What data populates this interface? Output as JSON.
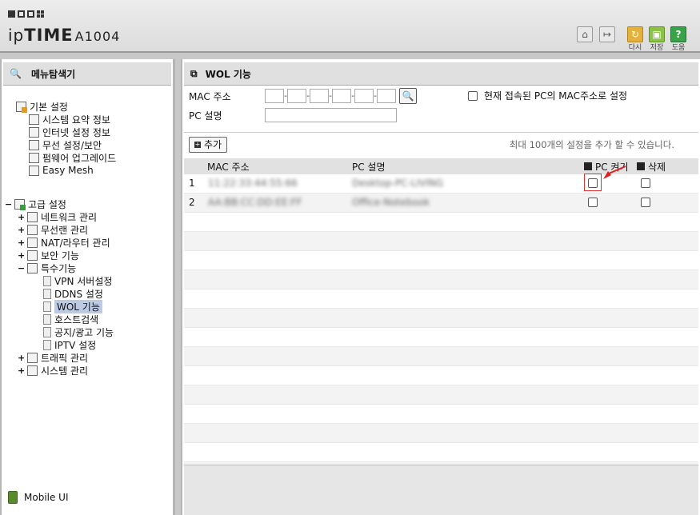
{
  "header": {
    "brand_ip": "ip",
    "brand_time": "TIME",
    "brand_model": "A1004",
    "buttons": [
      {
        "icon": "home-icon",
        "label": ""
      },
      {
        "icon": "logout-icon",
        "label": ""
      },
      {
        "icon": "refresh-icon",
        "label": "다시"
      },
      {
        "icon": "save-icon",
        "label": "저장"
      },
      {
        "icon": "help-icon",
        "label": "도움"
      }
    ],
    "help_glyph": "?"
  },
  "sidebar": {
    "title": "메뉴탐색기",
    "basic": {
      "label": "기본 설정",
      "items": [
        "시스템 요약 정보",
        "인터넷 설정 정보",
        "무선 설정/보안",
        "펌웨어 업그레이드",
        "Easy Mesh"
      ]
    },
    "advanced": {
      "label": "고급 설정",
      "items": [
        "네트워크 관리",
        "무선랜 관리",
        "NAT/라우터 관리",
        "보안 기능"
      ],
      "special": {
        "label": "특수기능",
        "items": [
          "VPN 서버설정",
          "DDNS 설정",
          "WOL 기능",
          "호스트검색",
          "공지/광고 기능",
          "IPTV 설정"
        ]
      },
      "after": [
        "트래픽 관리",
        "시스템 관리"
      ]
    },
    "mobile_ui": "Mobile UI",
    "expand_plus": "+",
    "expand_minus": "−"
  },
  "main": {
    "title": "WOL 기능",
    "mac_label": "MAC 주소",
    "pc_desc_label": "PC 설명",
    "current_pc_label": "현재 접속된 PC의 MAC주소로 설정",
    "add_button": "추가",
    "limit_note": "최대 100개의 설정을 추가 할 수 있습니다.",
    "table": {
      "headers": {
        "mac": "MAC 주소",
        "desc": "PC 설명",
        "wake": "PC 켜기",
        "delete": "삭제"
      },
      "rows": [
        {
          "num": "1",
          "mac": "11:22:33:44:55:66",
          "desc": "Desktop-PC-LIVING"
        },
        {
          "num": "2",
          "mac": "AA:BB:CC:DD:EE:FF",
          "desc": "Office-Notebook"
        }
      ]
    }
  }
}
